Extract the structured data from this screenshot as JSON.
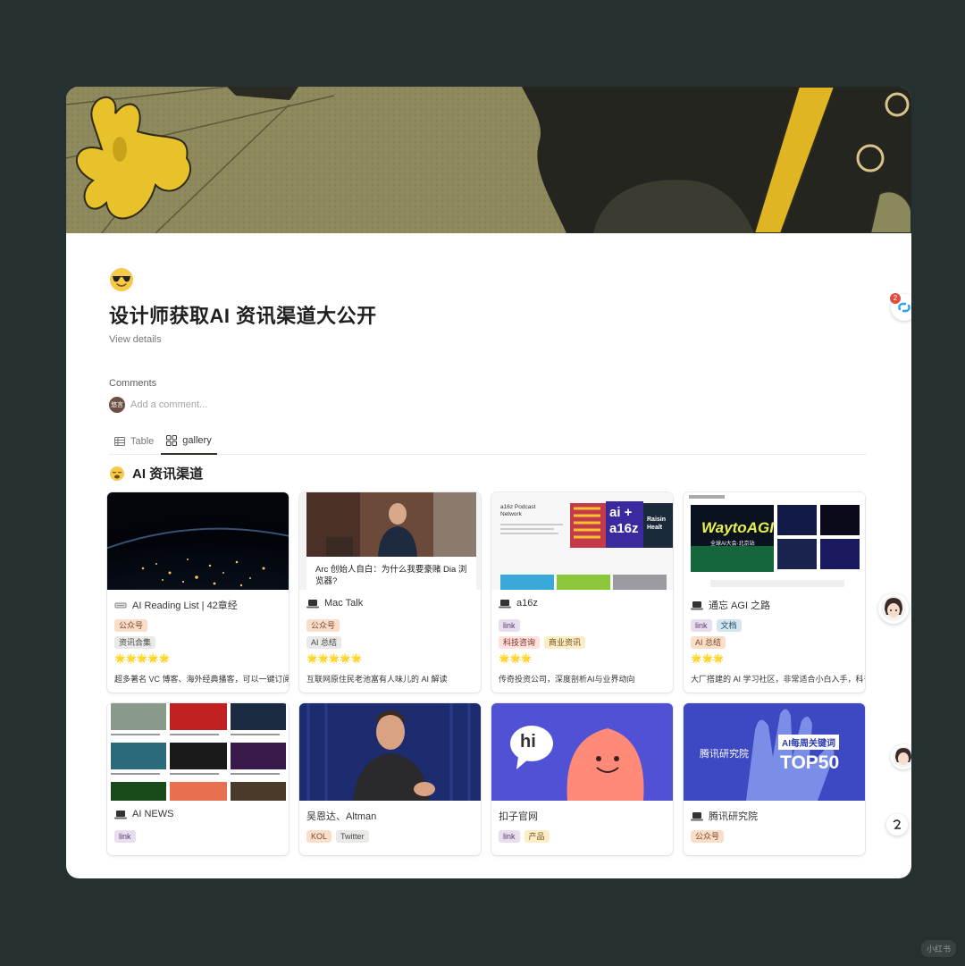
{
  "page": {
    "icon": "sunglasses-emoji-icon",
    "title": "设计师获取AI 资讯渠道大公开",
    "view_details": "View details"
  },
  "comments": {
    "label": "Comments",
    "avatar_text": "悠言",
    "placeholder": "Add a comment..."
  },
  "tabs": [
    {
      "label": "Table",
      "icon": "table-icon",
      "active": false
    },
    {
      "label": "gallery",
      "icon": "gallery-icon",
      "active": true
    }
  ],
  "section": {
    "icon": "sleepy-face-emoji-icon",
    "title": "AI 资讯渠道"
  },
  "cards": [
    {
      "name": "AI Reading List | 42章经",
      "tags": [
        "公众号"
      ],
      "tags2": [
        "资讯合集"
      ],
      "stars": "🌟🌟🌟🌟🌟",
      "desc": "超多著名 VC 博客、海外经典播客，可以一键订阅",
      "thumb_caption": ""
    },
    {
      "name": "Mac Talk",
      "tags": [
        "公众号"
      ],
      "tags2": [
        "AI 总结"
      ],
      "stars": "🌟🌟🌟🌟🌟",
      "desc": "互联网原住民老池富有人味儿的 AI 解读",
      "thumb_caption": "Arc 创始人自白：为什么我要豪赌 Dia 浏览器?"
    },
    {
      "name": "a16z",
      "tags": [
        "link"
      ],
      "tags2": [
        "科技咨询",
        "商业资讯"
      ],
      "stars": "🌟🌟🌟",
      "desc": "传奇投资公司，深度剖析AI与业界动向",
      "thumb_caption": "a16z Podcast Network"
    },
    {
      "name": "通忘 AGI 之路",
      "tags": [
        "link",
        "文档"
      ],
      "tags2": [
        "AI 总结"
      ],
      "stars": "🌟🌟🌟",
      "desc": "大厂搭建的 AI 学习社区，非常适合小白入手，科普",
      "thumb_caption": "WaytoAGI"
    },
    {
      "name": "AI NEWS",
      "tags": [
        "link"
      ],
      "tags2": [],
      "stars": "",
      "desc": "",
      "thumb_caption": ""
    },
    {
      "name": "吴恩达、Altman",
      "tags": [
        "KOL",
        "Twitter"
      ],
      "tags2": [],
      "stars": "",
      "desc": "",
      "thumb_caption": ""
    },
    {
      "name": "扣子官网",
      "tags": [
        "link",
        "产品"
      ],
      "tags2": [],
      "stars": "",
      "desc": "",
      "thumb_caption": "hi"
    },
    {
      "name": "腾讯研究院",
      "tags": [
        "公众号"
      ],
      "tags2": [],
      "stars": "",
      "desc": "",
      "thumb_caption": "腾讯研究院"
    }
  ],
  "thumb_text": {
    "a16z_ai": "ai +",
    "a16z_a16z": "a16z",
    "a16z_raise": "Raisin Healt",
    "tencent_badge": "AI每周关键词",
    "tencent_top": "TOP50",
    "waytoagi_sub": "全球AI大会·北京站"
  },
  "side": {
    "notification_count": "2"
  },
  "watermark": "小红书",
  "colors": {
    "background": "#253130",
    "tag_orange": "#fadec9",
    "tag_purple": "#e8deee",
    "tag_gray": "#e9e9e7",
    "star": "#e6b422"
  }
}
